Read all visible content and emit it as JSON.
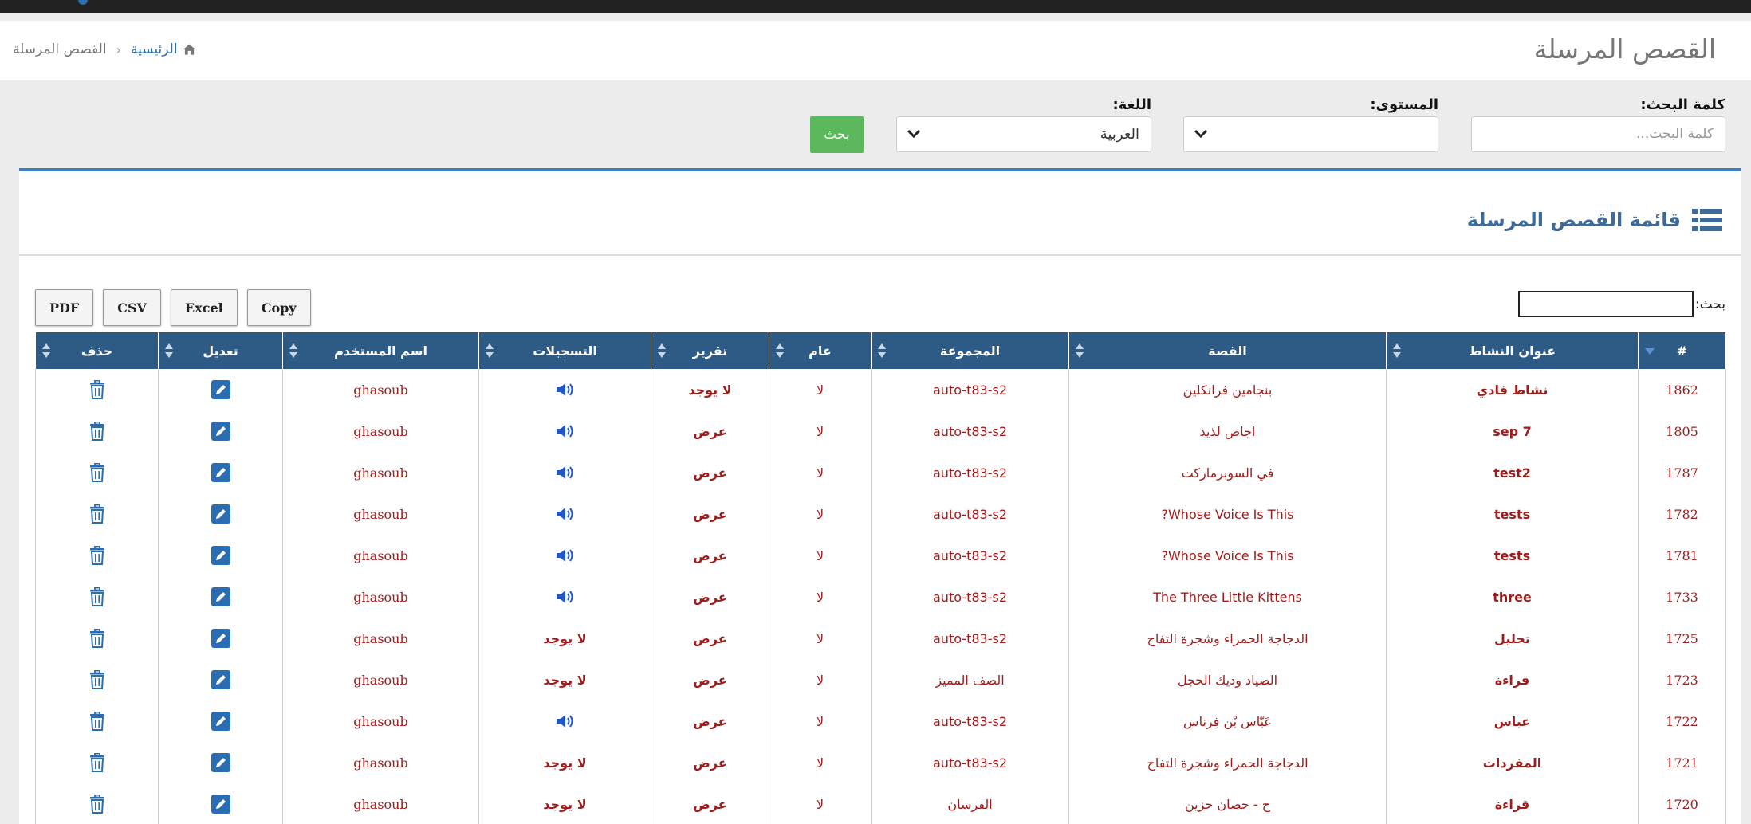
{
  "page": {
    "title": "القصص المرسلة"
  },
  "breadcrumb": {
    "home": "الرئيسية",
    "separator": "›",
    "current": "القصص المرسلة"
  },
  "filters": {
    "keyword_label": "كلمة البحث:",
    "keyword_placeholder": "كلمة البحث...",
    "level_label": "المستوى:",
    "level_value": "",
    "language_label": "اللغة:",
    "language_value": "العربية",
    "search_button": "بحث"
  },
  "panel": {
    "title": "قائمة القصص المرسلة"
  },
  "table_tools": {
    "export_buttons": [
      "PDF",
      "CSV",
      "Excel",
      "Copy"
    ],
    "search_label": "بحث:"
  },
  "table": {
    "columns": [
      "#",
      "عنوان النشاط",
      "القصة",
      "المجموعة",
      "عام",
      "تقرير",
      "التسجيلات",
      "اسم المستخدم",
      "تعديل",
      "حذف"
    ],
    "rows": [
      {
        "id": "1862",
        "activity": "نشاط فادي",
        "story": "بنجامين فرانكلين",
        "group": "auto-t83-s2",
        "public": "لا",
        "report": "لا يوجد",
        "recordings": "audio",
        "user": "ghasoub"
      },
      {
        "id": "1805",
        "activity": "sep 7",
        "story": "اجاص لذيذ",
        "group": "auto-t83-s2",
        "public": "لا",
        "report": "عرض",
        "recordings": "audio",
        "user": "ghasoub"
      },
      {
        "id": "1787",
        "activity": "test2",
        "story": "في السوبرماركت",
        "group": "auto-t83-s2",
        "public": "لا",
        "report": "عرض",
        "recordings": "audio",
        "user": "ghasoub"
      },
      {
        "id": "1782",
        "activity": "tests",
        "story": "Whose Voice Is This?",
        "group": "auto-t83-s2",
        "public": "لا",
        "report": "عرض",
        "recordings": "audio",
        "user": "ghasoub"
      },
      {
        "id": "1781",
        "activity": "tests",
        "story": "Whose Voice Is This?",
        "group": "auto-t83-s2",
        "public": "لا",
        "report": "عرض",
        "recordings": "audio",
        "user": "ghasoub"
      },
      {
        "id": "1733",
        "activity": "three",
        "story": "The Three Little Kittens",
        "group": "auto-t83-s2",
        "public": "لا",
        "report": "عرض",
        "recordings": "audio",
        "user": "ghasoub"
      },
      {
        "id": "1725",
        "activity": "تحليل",
        "story": "الدجاجة الحمراء وشجرة التفاح",
        "group": "auto-t83-s2",
        "public": "لا",
        "report": "عرض",
        "recordings": "لا يوجد",
        "user": "ghasoub"
      },
      {
        "id": "1723",
        "activity": "قراءة",
        "story": "الصياد وديك الحجل",
        "group": "الصف المميز",
        "public": "لا",
        "report": "عرض",
        "recordings": "لا يوجد",
        "user": "ghasoub"
      },
      {
        "id": "1722",
        "activity": "عباس",
        "story": "عَبّاس بْن  فِرناس",
        "group": "auto-t83-s2",
        "public": "لا",
        "report": "عرض",
        "recordings": "audio",
        "user": "ghasoub"
      },
      {
        "id": "1721",
        "activity": "المفردات",
        "story": "الدجاجة الحمراء وشجرة التفاح",
        "group": "auto-t83-s2",
        "public": "لا",
        "report": "عرض",
        "recordings": "لا يوجد",
        "user": "ghasoub"
      },
      {
        "id": "1720",
        "activity": "قراءة",
        "story": "ح - حصان حزين",
        "group": "الفرسان",
        "public": "لا",
        "report": "عرض",
        "recordings": "لا يوجد",
        "user": "ghasoub"
      }
    ]
  },
  "icons": {
    "home": "home-icon",
    "list": "list-icon",
    "audio": "speaker-icon",
    "edit": "pencil-icon",
    "delete": "trash-icon",
    "chevron": "chevron-down-icon",
    "sort": "sort-icon"
  },
  "colors": {
    "header_blue": "#2d5b86",
    "accent_blue": "#3c7fb8",
    "link_blue": "#1f1fc8",
    "green": "#5cb85c",
    "text_red": "#a01b1b",
    "view_green": "#1a8a1a"
  }
}
